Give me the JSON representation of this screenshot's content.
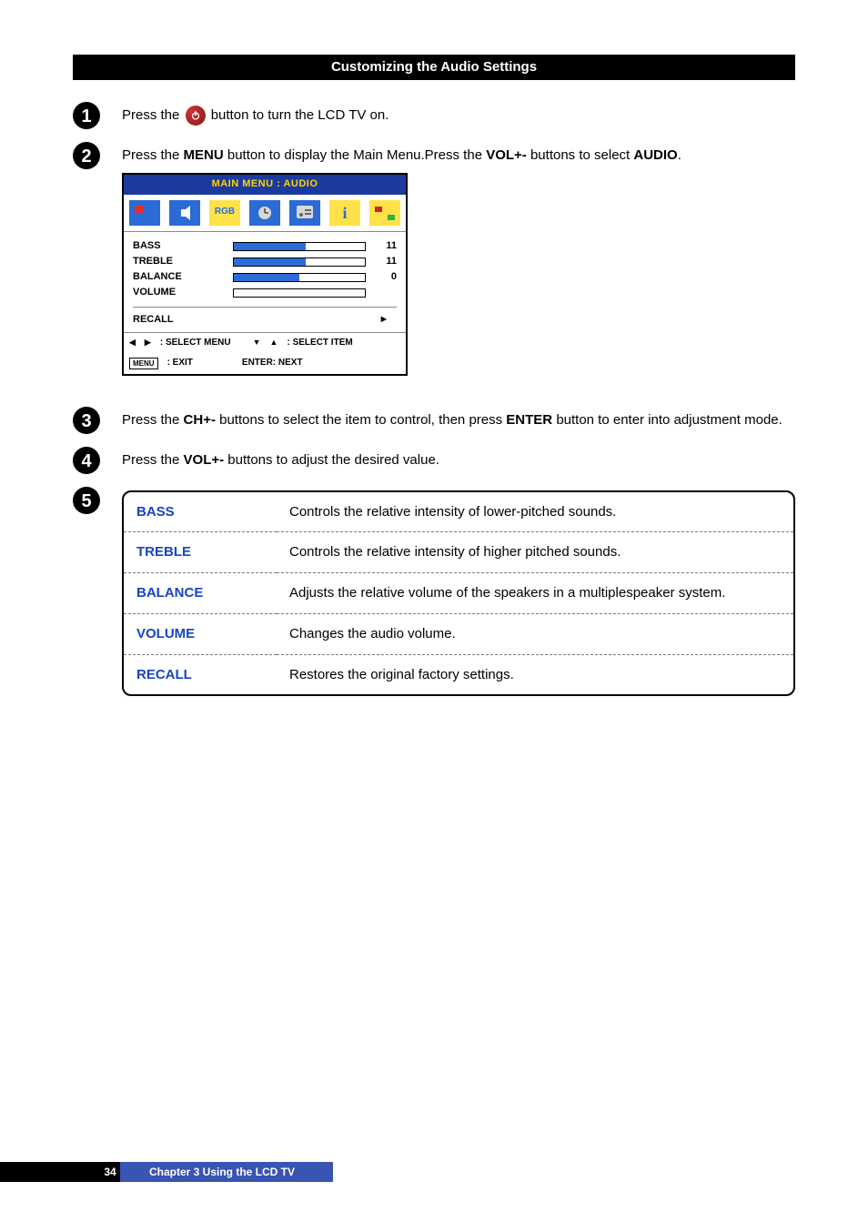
{
  "section_title": "Customizing the Audio Settings",
  "steps": {
    "s1": {
      "pre": "Press the ",
      "post": " button to turn the LCD TV on."
    },
    "s2": {
      "pre": "Press the ",
      "menu": "MENU",
      "mid": " button to display the Main Menu.Press the ",
      "vol": "VOL+-",
      "post": " buttons to select ",
      "audio": "AUDIO",
      "end": "."
    },
    "s3": {
      "pre": "Press the ",
      "ch": "CH+-",
      "mid": " buttons to select the item to control, then press ",
      "enter": "ENTER",
      "post": " button to enter into adjustment mode."
    },
    "s4": {
      "pre": "Press the ",
      "vol": "VOL+-",
      "post": " buttons to adjust the desired value."
    }
  },
  "osd": {
    "title": "MAIN MENU : AUDIO",
    "rgb_label": "RGB",
    "items": [
      {
        "label": "BASS",
        "value": "11",
        "fill": 55
      },
      {
        "label": "TREBLE",
        "value": "11",
        "fill": 55
      },
      {
        "label": "BALANCE",
        "value": "0",
        "fill": 50
      },
      {
        "label": "VOLUME",
        "value": "",
        "fill": 0
      }
    ],
    "recall": "RECALL",
    "hint_select_menu": ": SELECT MENU",
    "hint_select_item": ": SELECT ITEM",
    "hint_exit": " : EXIT",
    "hint_enter": "ENTER: NEXT"
  },
  "params": [
    {
      "k": "BASS",
      "v": "Controls the relative intensity of lower-pitched sounds."
    },
    {
      "k": "TREBLE",
      "v": "Controls the relative intensity of higher pitched sounds."
    },
    {
      "k": "BALANCE",
      "v": "Adjusts the relative volume of the speakers in a multiplespeaker system."
    },
    {
      "k": "VOLUME",
      "v": "Changes the audio volume."
    },
    {
      "k": "RECALL",
      "v": "Restores the original factory settings."
    }
  ],
  "footer": {
    "page": "34",
    "chapter": "Chapter 3 Using the LCD TV"
  }
}
